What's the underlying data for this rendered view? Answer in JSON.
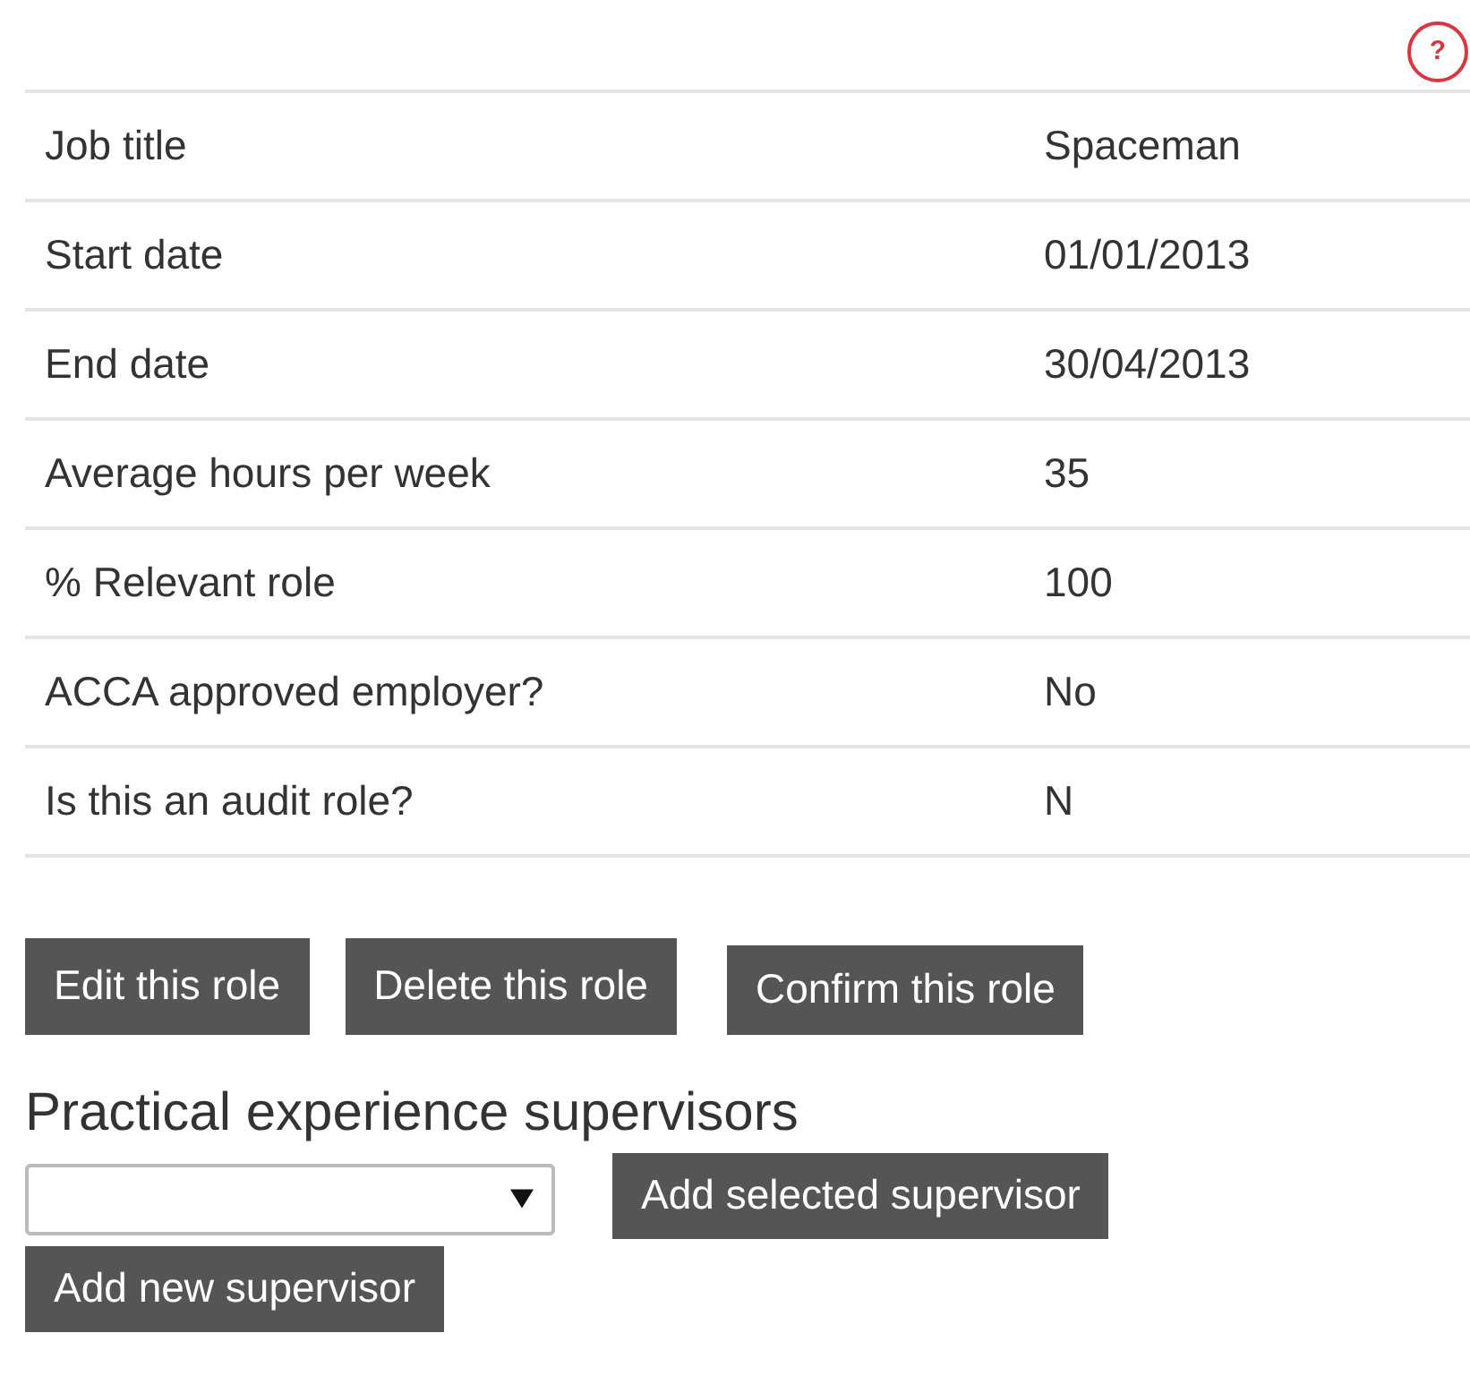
{
  "help_icon": "?",
  "details": [
    {
      "label": "Job title",
      "value": "Spaceman"
    },
    {
      "label": "Start date",
      "value": "01/01/2013"
    },
    {
      "label": "End date",
      "value": "30/04/2013"
    },
    {
      "label": "Average hours per week",
      "value": "35"
    },
    {
      "label": "% Relevant role",
      "value": "100"
    },
    {
      "label": "ACCA approved employer?",
      "value": "No"
    },
    {
      "label": "Is this an audit role?",
      "value": "N"
    }
  ],
  "role_buttons": [
    "Edit this role",
    "Delete this role",
    "Confirm this role"
  ],
  "supervisors": {
    "heading": "Practical experience supervisors",
    "add_selected_button": "Add selected supervisor",
    "add_new_button": "Add new supervisor"
  }
}
